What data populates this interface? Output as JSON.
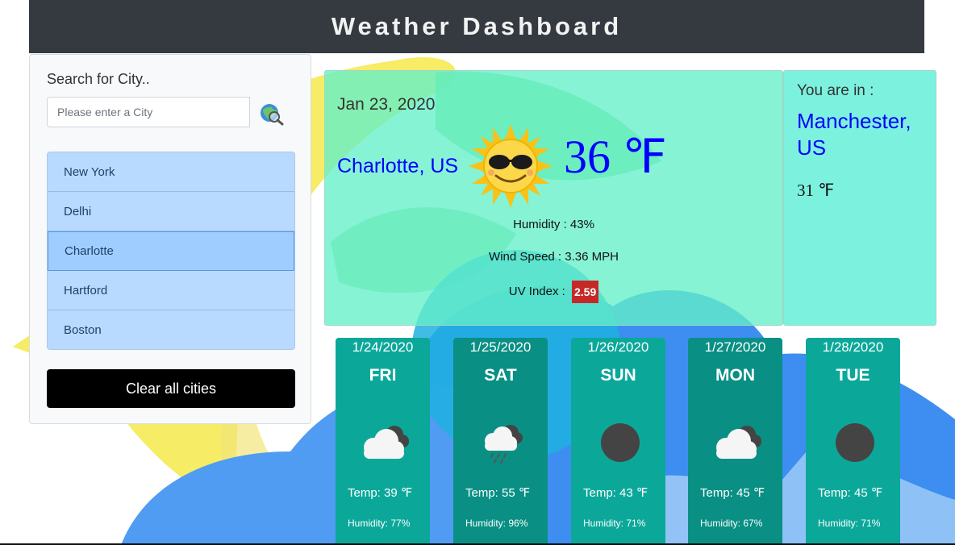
{
  "header": {
    "title": "Weather Dashboard"
  },
  "sidebar": {
    "search_label": "Search for City..",
    "search_placeholder": "Please enter a City",
    "search_icon": "globe-search-icon",
    "cities": [
      "New York",
      "Delhi",
      "Charlotte",
      "Hartford",
      "Boston"
    ],
    "active_city": "Charlotte",
    "clear_label": "Clear all cities"
  },
  "current": {
    "date": "Jan 23, 2020",
    "city": "Charlotte, US",
    "icon": "sun-sunglasses-icon",
    "temp": "36 ℉",
    "humidity": "Humidity : 43%",
    "wind": "Wind Speed : 3.36 MPH",
    "uv_label": "UV Index :",
    "uv_value": "2.59",
    "uv_color": "#c62828"
  },
  "location": {
    "label": "You are in :",
    "city": "Manchester, US",
    "temp": "31 ℉"
  },
  "forecast": [
    {
      "date": "1/24/2020",
      "day": "FRI",
      "icon": "cloud-icon",
      "temp": "Temp: 39 ℉",
      "humidity": "Humidity: 77%",
      "color": "#0ba89a"
    },
    {
      "date": "1/25/2020",
      "day": "SAT",
      "icon": "rain-cloud-icon",
      "temp": "Temp: 55 ℉",
      "humidity": "Humidity: 96%",
      "color": "#098f84"
    },
    {
      "date": "1/26/2020",
      "day": "SUN",
      "icon": "dark-circle-icon",
      "temp": "Temp: 43 ℉",
      "humidity": "Humidity: 71%",
      "color": "#0ba89a"
    },
    {
      "date": "1/27/2020",
      "day": "MON",
      "icon": "cloud-icon",
      "temp": "Temp: 45 ℉",
      "humidity": "Humidity: 67%",
      "color": "#098f84"
    },
    {
      "date": "1/28/2020",
      "day": "TUE",
      "icon": "dark-circle-icon",
      "temp": "Temp: 45 ℉",
      "humidity": "Humidity: 71%",
      "color": "#0ba89a"
    }
  ]
}
